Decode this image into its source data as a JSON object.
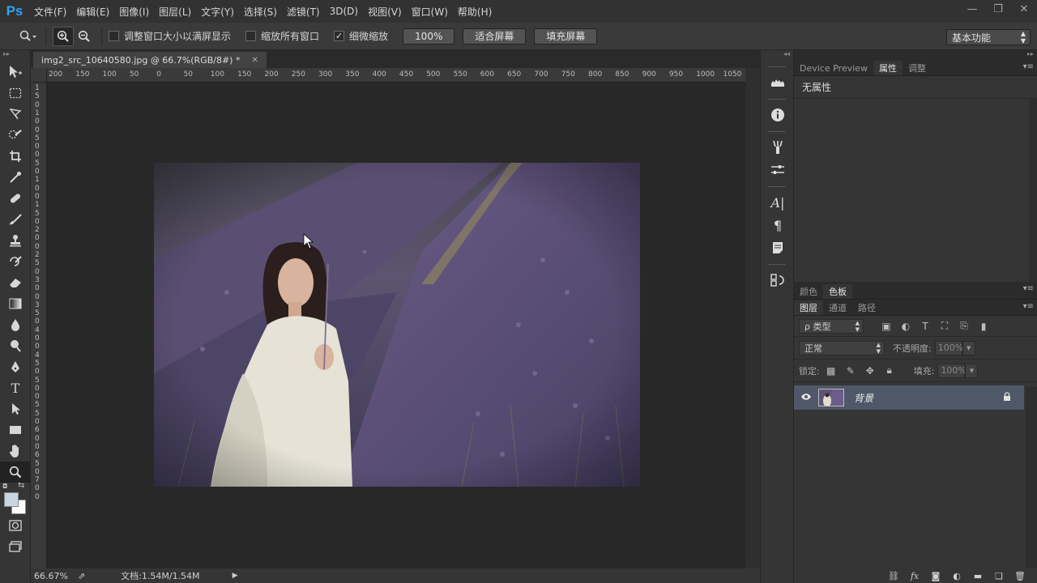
{
  "app": {
    "logo": "Ps"
  },
  "menu": [
    "文件(F)",
    "编辑(E)",
    "图像(I)",
    "图层(L)",
    "文字(Y)",
    "选择(S)",
    "滤镜(T)",
    "3D(D)",
    "视图(V)",
    "窗口(W)",
    "帮助(H)"
  ],
  "window_controls": {
    "minimize": "—",
    "restore": "❐",
    "close": "✕"
  },
  "options": {
    "resize_windows": {
      "label": "调整窗口大小以满屏显示",
      "checked": false
    },
    "zoom_all_windows": {
      "label": "缩放所有窗口",
      "checked": false
    },
    "scrubby_zoom": {
      "label": "细微缩放",
      "checked": true
    },
    "btn_100": "100%",
    "btn_fit": "适合屏幕",
    "btn_fill": "填充屏幕",
    "workspace": "基本功能"
  },
  "document": {
    "tab_title": "img2_src_10640580.jpg @ 66.7%(RGB/8#) *",
    "close": "✕"
  },
  "ruler_h": [
    "200",
    "150",
    "100",
    "50",
    "0",
    "50",
    "100",
    "150",
    "200",
    "250",
    "300",
    "350",
    "400",
    "450",
    "500",
    "550",
    "600",
    "650",
    "700",
    "750",
    "800",
    "850",
    "900",
    "950",
    "1000",
    "1050"
  ],
  "ruler_v": [
    "1",
    "5",
    "0",
    "1",
    "0",
    "0",
    "5",
    "0",
    "0",
    "5",
    "0",
    "1",
    "0",
    "0",
    "1",
    "5",
    "0",
    "2",
    "0",
    "0",
    "2",
    "5",
    "0",
    "3",
    "0",
    "0",
    "3",
    "5",
    "0",
    "4",
    "0",
    "0",
    "4",
    "5",
    "0",
    "5",
    "0",
    "0",
    "5",
    "5",
    "0",
    "6",
    "0",
    "0",
    "6",
    "5",
    "0",
    "7",
    "0",
    "0"
  ],
  "status": {
    "zoom": "66.67%",
    "doc_size": "文档:1.54M/1.54M"
  },
  "properties_panel": {
    "tabs": [
      "Device Preview",
      "属性",
      "调整"
    ],
    "active_tab": 1,
    "content": "无属性"
  },
  "color_panel": {
    "tabs": [
      "颜色",
      "色板"
    ],
    "active_tab": 1
  },
  "layers_panel": {
    "tabs": [
      "图层",
      "通道",
      "路径"
    ],
    "active_tab": 0,
    "filter_type": "ρ 类型",
    "blend_mode": "正常",
    "opacity_label": "不透明度:",
    "opacity_value": "100%",
    "lock_label": "锁定:",
    "fill_label": "填充:",
    "fill_value": "100%",
    "layers": [
      {
        "name": "背景",
        "visible": true,
        "locked": true
      }
    ]
  },
  "colors": {
    "foreground": "#c9d6df",
    "background": "#ffffff",
    "accent": "#2fa3f7"
  }
}
